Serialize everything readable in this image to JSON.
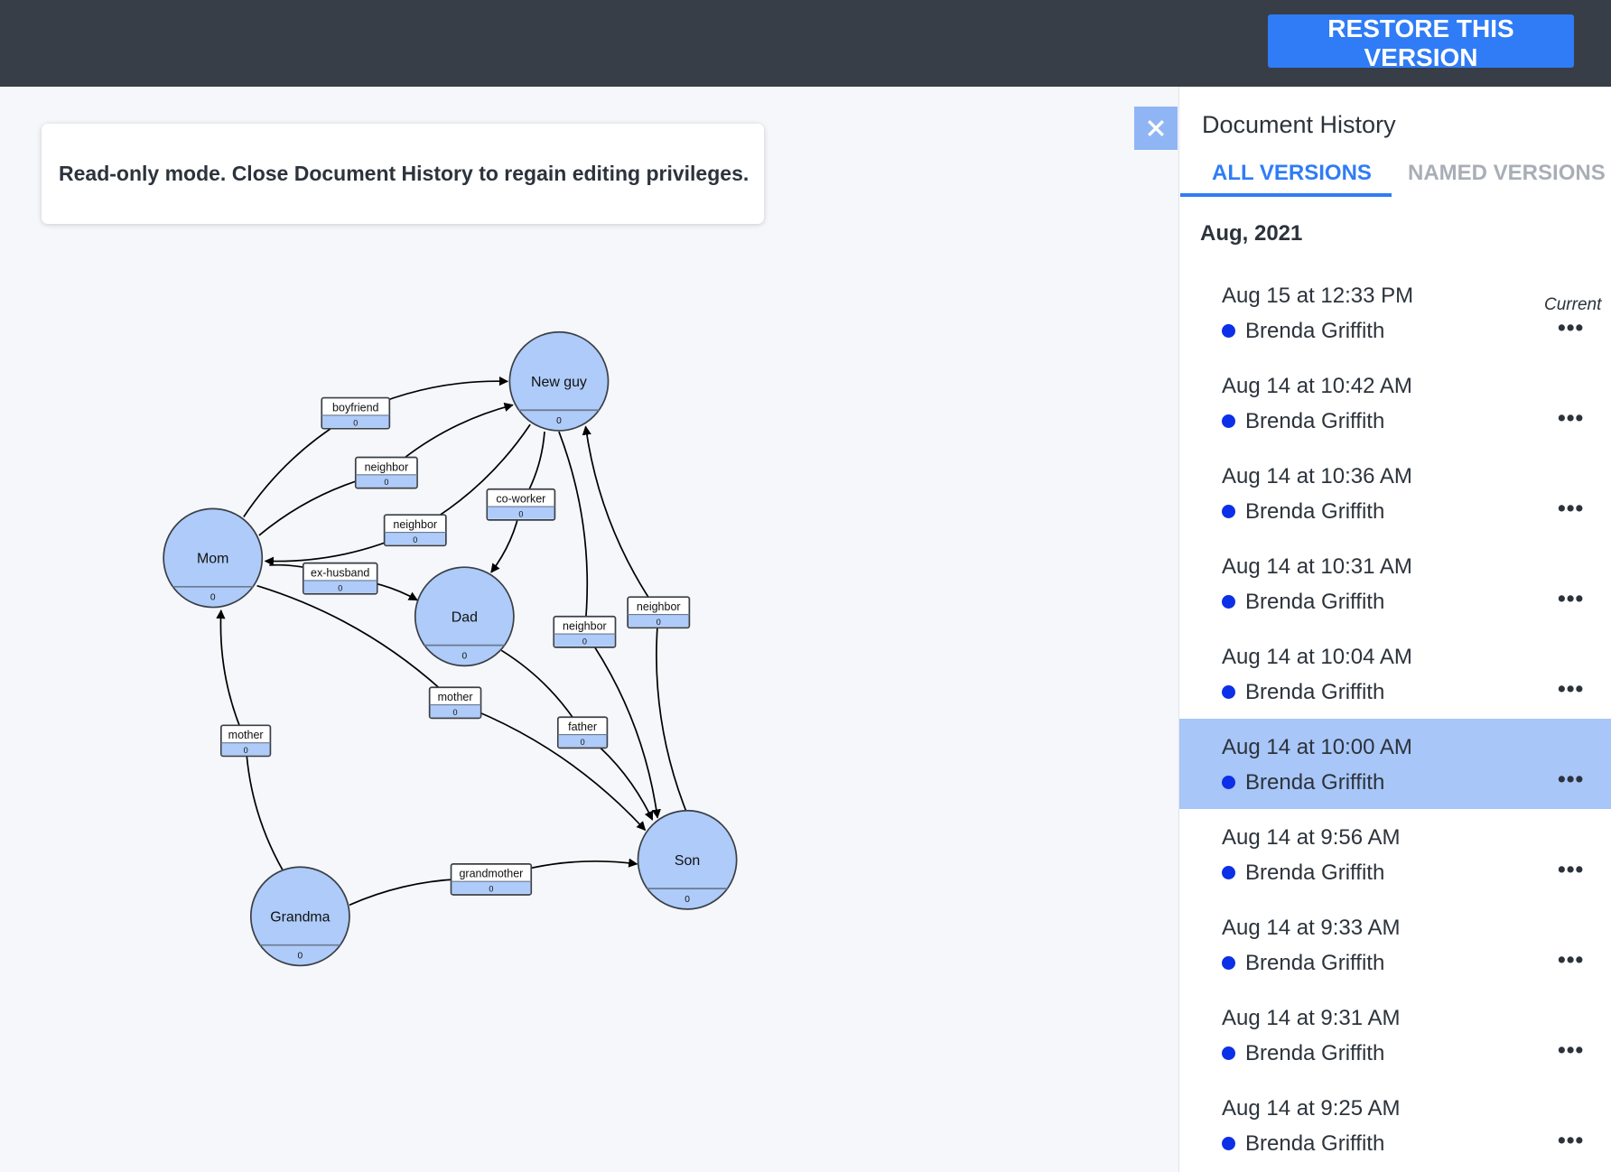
{
  "toolbar": {
    "restore_label": "RESTORE THIS VERSION"
  },
  "banner": {
    "text": "Read-only mode. Close Document History to regain editing privileges."
  },
  "close_icon": "close-icon",
  "history": {
    "title": "Document History",
    "tabs": [
      {
        "label": "ALL VERSIONS",
        "active": true
      },
      {
        "label": "NAMED VERSIONS",
        "active": false
      }
    ],
    "month": "Aug, 2021",
    "current_label": "Current",
    "more_label": "•••",
    "entries": [
      {
        "time": "Aug 15 at 12:33 PM",
        "author": "Brenda Griffith",
        "current": true
      },
      {
        "time": "Aug 14 at 10:42 AM",
        "author": "Brenda Griffith"
      },
      {
        "time": "Aug 14 at 10:36 AM",
        "author": "Brenda Griffith"
      },
      {
        "time": "Aug 14 at 10:31 AM",
        "author": "Brenda Griffith"
      },
      {
        "time": "Aug 14 at 10:04 AM",
        "author": "Brenda Griffith"
      },
      {
        "time": "Aug 14 at 10:00 AM",
        "author": "Brenda Griffith",
        "selected": true
      },
      {
        "time": "Aug 14 at 9:56 AM",
        "author": "Brenda Griffith"
      },
      {
        "time": "Aug 14 at 9:33 AM",
        "author": "Brenda Griffith"
      },
      {
        "time": "Aug 14 at 9:31 AM",
        "author": "Brenda Griffith"
      },
      {
        "time": "Aug 14 at 9:25 AM",
        "author": "Brenda Griffith"
      }
    ],
    "author_color": "#0c2fe8",
    "selected_color": "#a8c6f8"
  },
  "graph": {
    "node_color": "#aecbf9",
    "nodes": [
      {
        "id": "newguy",
        "label": "New guy",
        "count": "0"
      },
      {
        "id": "mom",
        "label": "Mom",
        "count": "0"
      },
      {
        "id": "dad",
        "label": "Dad",
        "count": "0"
      },
      {
        "id": "son",
        "label": "Son",
        "count": "0"
      },
      {
        "id": "grandma",
        "label": "Grandma",
        "count": "0"
      }
    ],
    "edges": [
      {
        "id": "e1",
        "from": "mom",
        "to": "newguy",
        "label": "boyfriend",
        "count": "0"
      },
      {
        "id": "e2",
        "from": "mom",
        "to": "newguy",
        "label": "neighbor",
        "count": "0"
      },
      {
        "id": "e3",
        "from": "newguy",
        "to": "mom",
        "label": "neighbor",
        "count": "0"
      },
      {
        "id": "e4",
        "from": "newguy",
        "to": "dad",
        "label": "co-worker",
        "count": "0"
      },
      {
        "id": "e5",
        "from": "mom",
        "to": "dad",
        "label": "ex-husband",
        "count": "0"
      },
      {
        "id": "e6",
        "from": "newguy",
        "to": "son",
        "label": "neighbor",
        "count": "0"
      },
      {
        "id": "e7",
        "from": "son",
        "to": "newguy",
        "label": "neighbor",
        "count": "0"
      },
      {
        "id": "e8",
        "from": "mom",
        "to": "son",
        "label": "mother",
        "count": "0"
      },
      {
        "id": "e9",
        "from": "dad",
        "to": "son",
        "label": "father",
        "count": "0"
      },
      {
        "id": "e10",
        "from": "grandma",
        "to": "mom",
        "label": "mother",
        "count": "0"
      },
      {
        "id": "e11",
        "from": "grandma",
        "to": "son",
        "label": "grandmother",
        "count": "0"
      }
    ]
  }
}
